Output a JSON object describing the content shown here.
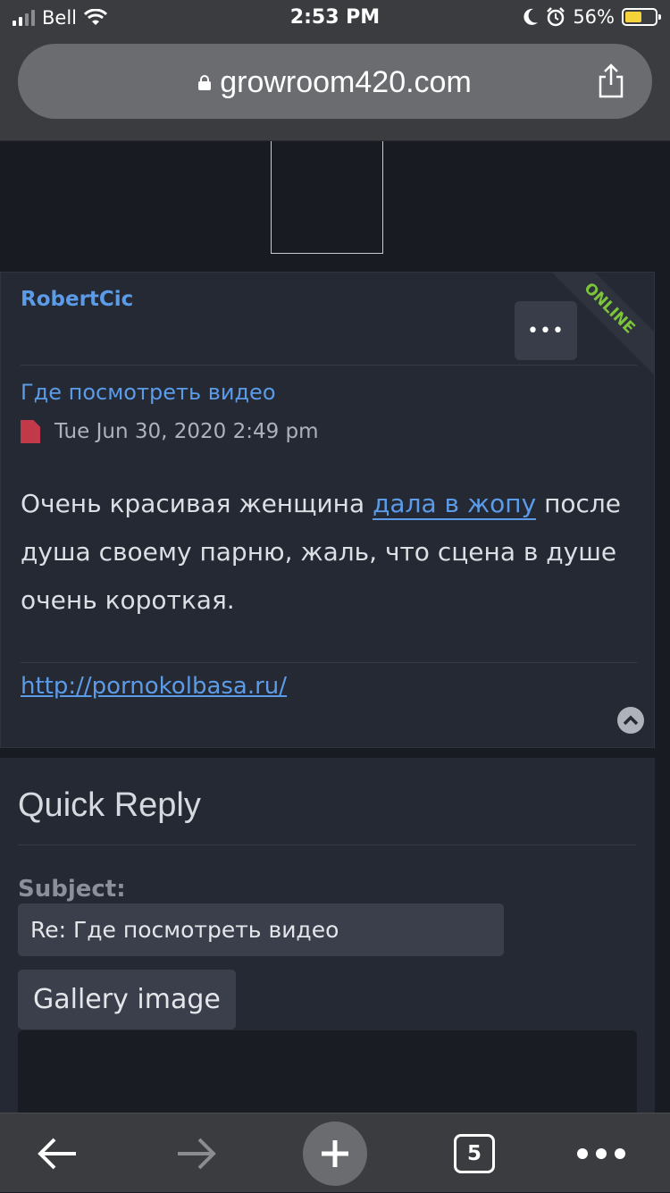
{
  "status_bar": {
    "carrier": "Bell",
    "time": "2:53 PM",
    "battery_percent": "56%",
    "battery_level": 0.56,
    "icons": [
      "signal-icon",
      "wifi-icon",
      "moon-icon",
      "alarm-icon",
      "battery-icon"
    ]
  },
  "browser": {
    "url": "growroom420.com",
    "tab_count": "5"
  },
  "post": {
    "author": "RobertCic",
    "status": "ONLINE",
    "more_label": "•••",
    "title": "Где посмотреть видео",
    "date": "Tue Jun 30, 2020 2:49 pm",
    "body_before": "Очень красивая женщина ",
    "body_link": "дала в жопу",
    "body_after": " после душа своему парню, жаль, что сцена в душе очень короткая.",
    "signature_link": "http://pornokolbasa.ru/"
  },
  "quick_reply": {
    "title": "Quick Reply",
    "subject_label": "Subject:",
    "subject_value": "Re: Где посмотреть видео",
    "gallery_button": "Gallery image"
  },
  "colors": {
    "link": "#5b9be8",
    "online": "#7bc43b",
    "panel": "#252934",
    "page_bg": "#181b22"
  }
}
